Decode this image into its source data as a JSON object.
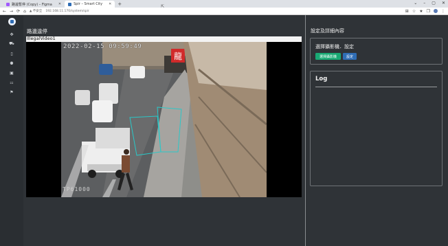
{
  "browser": {
    "tabs": [
      {
        "label": "路邊暫停 (Copy) – Figma",
        "icon_color": "#a259ff",
        "active": false
      },
      {
        "label": "Spir – Smart City",
        "icon_color": "#2f6db5",
        "active": true
      }
    ],
    "new_tab": "+",
    "window_controls": [
      "⌄",
      "–",
      "▢",
      "✕"
    ],
    "nav": {
      "back": "←",
      "forward": "→",
      "reload": "⟳",
      "home": "⌂"
    },
    "security": "▲ 不安全",
    "url": "192.168.11.170/system/spir",
    "right_icons": [
      "⊞",
      "☆",
      "★",
      "❐"
    ]
  },
  "sidebar": {
    "icons": [
      "logo-icon",
      "move-icon",
      "car-icon",
      "trash-icon",
      "user-add-icon",
      "bus-icon",
      "parking-icon",
      "megaphone-icon"
    ],
    "glyphs": [
      "✥",
      "⛟",
      "▯",
      "⚉",
      "▣",
      "⚏",
      "⚑"
    ]
  },
  "main": {
    "page_title": "路邊違停",
    "video_label": "IllegalVideo1",
    "timestamp": "2022-02-15 09:59:49",
    "camera_id": "TP61000",
    "sign_text": "龍"
  },
  "panel": {
    "title": "設定及詳細內容",
    "camera_box_title": "選擇攝影機．設定",
    "select_camera_button": "選擇攝影機",
    "settings_button": "設定",
    "log_title": "Log"
  }
}
